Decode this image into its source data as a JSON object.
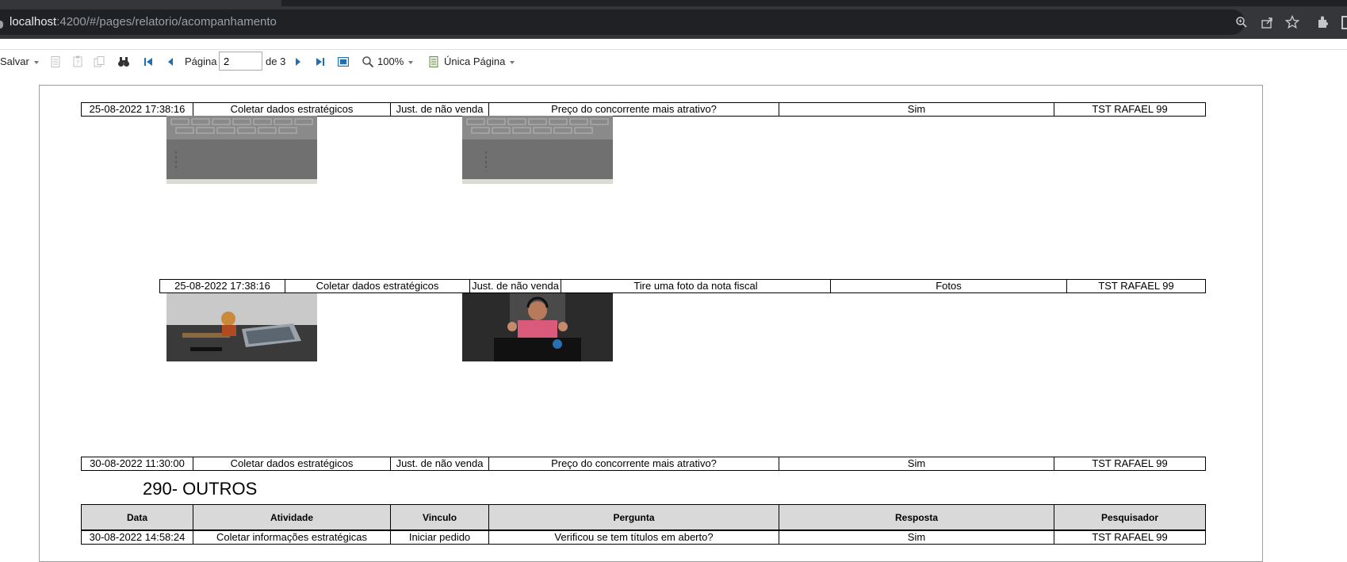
{
  "browser": {
    "url_host": "localhost",
    "url_path": ":4200/#/pages/relatorio/acompanhamento"
  },
  "toolbar": {
    "save_label": "Salvar",
    "page_label": "Página",
    "page_value": "2",
    "of_label": "de 3",
    "zoom_label": "100%",
    "view_mode_label": "Única Página"
  },
  "report": {
    "rows": [
      {
        "date": "25-08-2022 17:38:16",
        "atividade": "Coletar dados estratégicos",
        "vinculo": "Just. de não venda",
        "pergunta": "Preço do concorrente mais atrativo?",
        "resposta": "Sim",
        "pesquisador": "TST RAFAEL 99"
      },
      {
        "date": "25-08-2022 17:38:16",
        "atividade": "Coletar dados estratégicos",
        "vinculo": "Just. de não venda",
        "pergunta": "Tire uma foto da nota fiscal",
        "resposta": "Fotos",
        "pesquisador": "TST RAFAEL 99"
      },
      {
        "date": "30-08-2022 11:30:00",
        "atividade": "Coletar dados estratégicos",
        "vinculo": "Just. de não venda",
        "pergunta": "Preço do concorrente mais atrativo?",
        "resposta": "Sim",
        "pesquisador": "TST RAFAEL 99"
      }
    ],
    "section_title": "290- OUTROS",
    "headers": [
      "Data",
      "Atividade",
      "Vinculo",
      "Pergunta",
      "Resposta",
      "Pesquisador"
    ],
    "section_rows": [
      {
        "date": "30-08-2022 14:58:24",
        "atividade": "Coletar informações estratégicas",
        "vinculo": "Iniciar pedido",
        "pergunta": "Verificou se tem títulos em aberto?",
        "resposta": "Sim",
        "pesquisador": "TST RAFAEL 99"
      }
    ]
  },
  "colors": {
    "accent_blue": "#1f6fb5",
    "header_bg": "#d9d9d9"
  }
}
